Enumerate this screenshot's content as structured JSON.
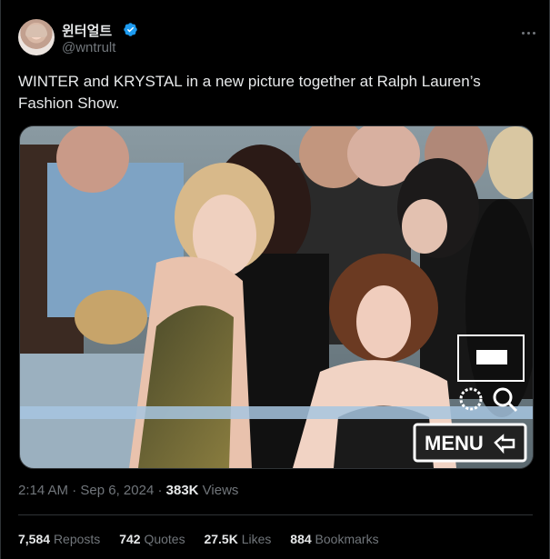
{
  "user": {
    "display_name": "윈터얼트",
    "handle": "@wntrult",
    "verified": true
  },
  "tweet": {
    "text": "WINTER and KRYSTAL in a new picture together at Ralph Lauren’s Fashion Show.",
    "image": {
      "overlay": {
        "menu_label": "MENU"
      }
    }
  },
  "meta": {
    "time": "2:14 AM",
    "separator": "·",
    "date": "Sep 6, 2024",
    "views_count": "383K",
    "views_label": "Views"
  },
  "stats": {
    "reposts_count": "7,584",
    "reposts_label": "Reposts",
    "quotes_count": "742",
    "quotes_label": "Quotes",
    "likes_count": "27.5K",
    "likes_label": "Likes",
    "bookmarks_count": "884",
    "bookmarks_label": "Bookmarks"
  },
  "colors": {
    "background": "#000000",
    "text_primary": "#e7e9ea",
    "text_secondary": "#71767b",
    "divider": "#2f3336",
    "verified": "#1d9bf0"
  }
}
